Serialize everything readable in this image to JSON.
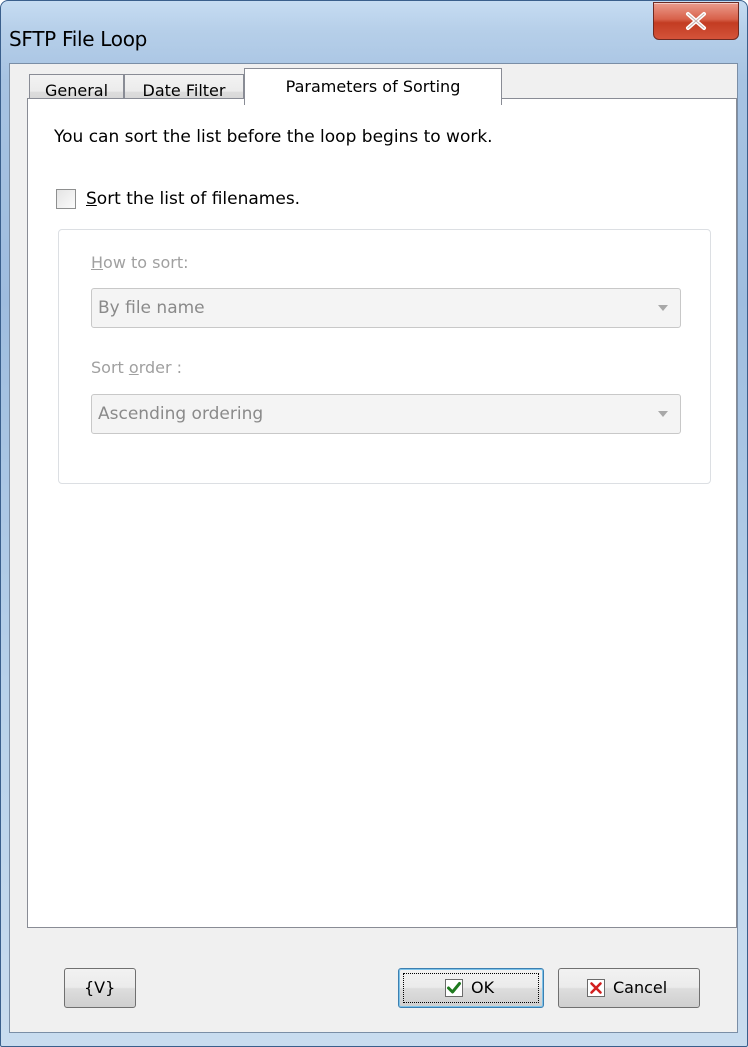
{
  "window": {
    "title": "SFTP File Loop"
  },
  "tabs": [
    {
      "label": "General",
      "active": false
    },
    {
      "label": "Date Filter",
      "active": false
    },
    {
      "label": "Parameters of Sorting",
      "active": true
    }
  ],
  "sorting": {
    "intro": "You can sort the list before the loop begins to work.",
    "sort_checkbox": {
      "label": "Sort the list of filenames.",
      "accel": "S",
      "rest": "ort the list of filenames.",
      "checked": false
    },
    "how_to_sort": {
      "label": "How to sort:",
      "accel": "H",
      "rest": "ow to sort:",
      "value": "By file name",
      "enabled": false
    },
    "sort_order": {
      "label_pre": "Sort ",
      "accel": "o",
      "label_post": "rder :",
      "value": "Ascending ordering",
      "enabled": false
    }
  },
  "footer": {
    "variables_label": "{V}",
    "ok_label": "OK",
    "cancel_label": "Cancel"
  },
  "colors": {
    "ok_check": "#1f7a1f",
    "cancel_x": "#d21f1f",
    "close_button": "#c33c22"
  }
}
